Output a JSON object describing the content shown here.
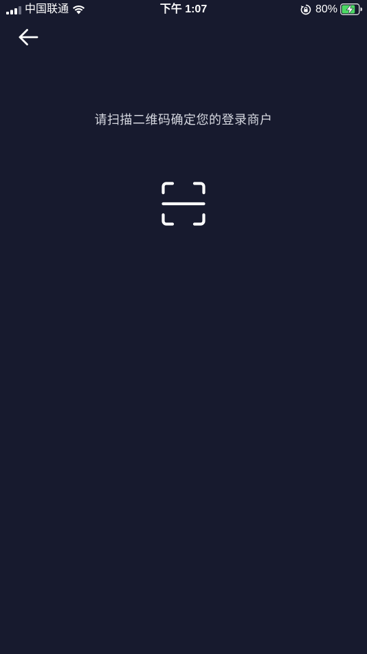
{
  "status_bar": {
    "carrier": "中国联通",
    "time": "下午 1:07",
    "battery_percent": "80%",
    "battery_level": 0.8,
    "icons": [
      "signal-icon",
      "wifi-icon",
      "rotation-lock-icon",
      "battery-charging-icon"
    ]
  },
  "nav": {
    "back_icon": "arrow-left-icon"
  },
  "main": {
    "instruction": "请扫描二维码确定您的登录商户",
    "scan_icon": "scan-qr-icon"
  },
  "colors": {
    "background": "#171a2e",
    "text": "#d6d8e0",
    "battery_charge": "#4cd964"
  }
}
